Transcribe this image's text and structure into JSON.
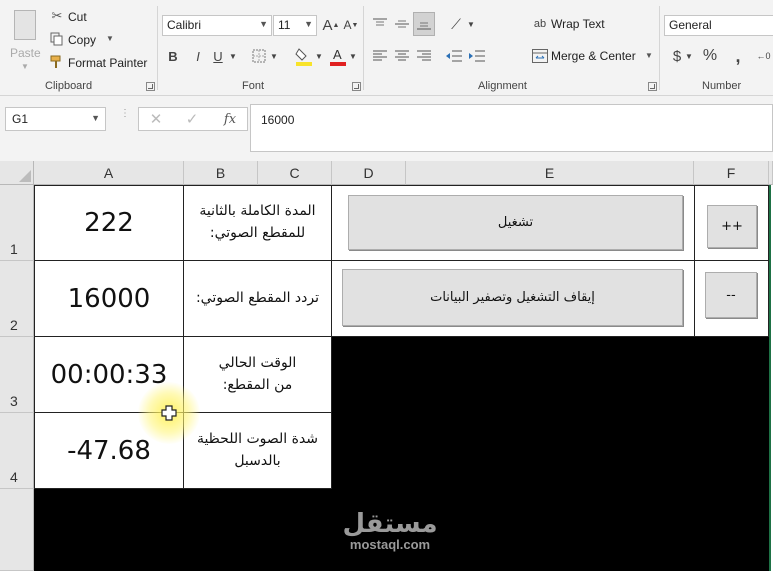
{
  "ribbon": {
    "clipboard": {
      "paste": "Paste",
      "cut": "Cut",
      "copy": "Copy",
      "format_painter": "Format Painter",
      "label": "Clipboard"
    },
    "font": {
      "name": "Calibri",
      "size": "11",
      "bold": "B",
      "italic": "I",
      "underline": "U",
      "label": "Font"
    },
    "alignment": {
      "wrap_text": "Wrap Text",
      "merge_center": "Merge & Center",
      "label": "Alignment"
    },
    "number": {
      "format": "General",
      "currency": "$",
      "percent": "%",
      "label": "Number"
    }
  },
  "formula_bar": {
    "name_box": "G1",
    "fx": "fx",
    "value": "16000"
  },
  "columns": [
    "A",
    "B",
    "C",
    "D",
    "E",
    "F"
  ],
  "rows": [
    "1",
    "2",
    "3",
    "4"
  ],
  "cells": {
    "a1": "222",
    "b1": "المدة الكاملة بالثانية للمقطع الصوتي:",
    "a2": "16000",
    "b2": "تردد المقطع الصوتي:",
    "a3": "00:00:33",
    "b3": "الوقت الحالي من المقطع:",
    "a4": "-47.68",
    "b4": "شدة الصوت اللحظية بالدسبل"
  },
  "sheet_buttons": {
    "play": "تشغيل",
    "stop_reset": "إيقاف التشغيل وتصفير البيانات",
    "increase": "++",
    "decrease": "--"
  },
  "watermark": {
    "arabic": "مستقل",
    "latin": "mostaql.com"
  }
}
